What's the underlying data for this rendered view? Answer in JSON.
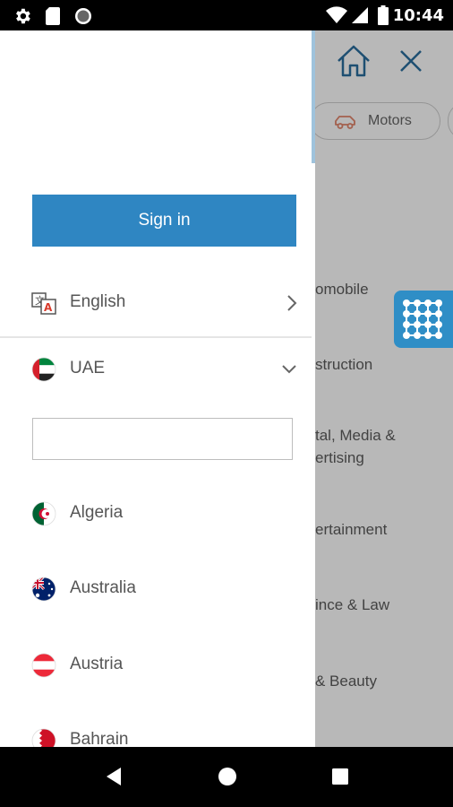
{
  "status_bar": {
    "time": "10:44",
    "icons": [
      "gear-icon",
      "sd-card-icon",
      "circle-icon",
      "wifi-icon",
      "signal-icon",
      "battery-icon"
    ]
  },
  "background_app": {
    "icons": [
      "home-icon",
      "close-icon",
      "car-icon",
      "grid-icon"
    ],
    "chip_label": "Motors",
    "categories": [
      "omobile",
      "struction",
      "tal, Media &\nertising",
      "ertainment",
      "ince & Law",
      "& Beauty"
    ]
  },
  "drawer": {
    "sign_in_label": "Sign in",
    "language": {
      "label": "English",
      "icon": "translate-icon"
    },
    "country": {
      "label": "UAE",
      "icon": "flag-uae-icon"
    },
    "search": {
      "value": "",
      "placeholder": ""
    },
    "countries": [
      {
        "label": "Algeria",
        "icon": "flag-algeria-icon"
      },
      {
        "label": "Australia",
        "icon": "flag-australia-icon"
      },
      {
        "label": "Austria",
        "icon": "flag-austria-icon"
      },
      {
        "label": "Bahrain",
        "icon": "flag-bahrain-icon"
      }
    ]
  },
  "nav_bar": {
    "icons": [
      "back-icon",
      "home-nav-icon",
      "recents-icon"
    ]
  },
  "colors": {
    "accent": "#2f86c2",
    "fab": "#2f8ec6",
    "header_icon": "#2a6e9e",
    "car_icon": "#e2866c",
    "text": "#555555"
  }
}
